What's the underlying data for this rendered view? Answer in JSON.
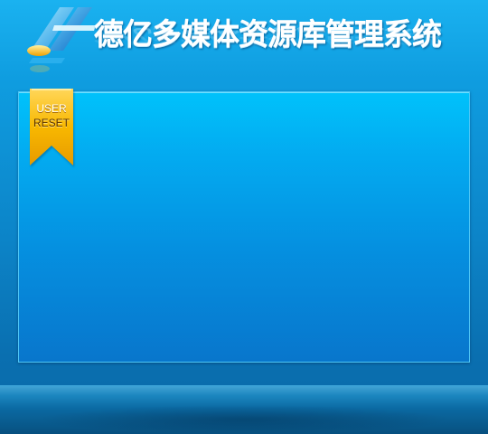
{
  "header": {
    "title": "德亿多媒体资源库管理系统"
  },
  "ribbon": {
    "line1": "USER",
    "line2": "RESET"
  },
  "colors": {
    "background": "#0f9de0",
    "panel_top": "#00c2fb",
    "panel_bottom": "#0876cc",
    "ribbon_gold": "#f7b500",
    "title_text": "#ffffff"
  },
  "icons": {
    "logo": "brand-logo-icon"
  }
}
